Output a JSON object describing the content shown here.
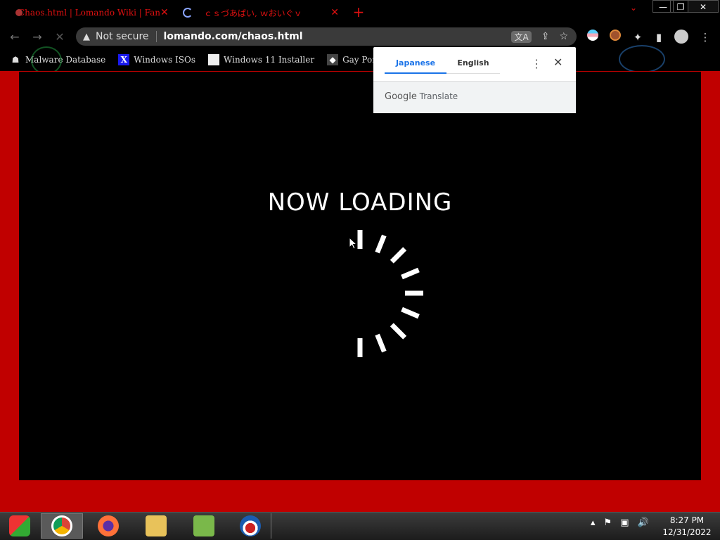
{
  "tabs": [
    {
      "title": "Chaos.html | Lomando Wiki | Fan",
      "close": "✕"
    },
    {
      "title": "ｃｓづあばい, ｗおいぐｖ",
      "close": "✕"
    }
  ],
  "new_tab": "+",
  "window_controls": {
    "minimize": "—",
    "maximize": "❐",
    "close": "✕"
  },
  "tab_search": "⌄",
  "nav": {
    "back": "←",
    "forward": "→",
    "stop": "✕"
  },
  "omnibox": {
    "warning_icon": "▲",
    "security": "Not secure",
    "url": "lomando.com/chaos.html",
    "translate_icon": "文A",
    "share_icon": "⇪",
    "bookmark_icon": "☆"
  },
  "toolbar_icons": {
    "puzzle": "✦",
    "sidebar": "▮",
    "menu": "⋮"
  },
  "bookmarks": [
    {
      "label": "Malware Database",
      "icon": "☗"
    },
    {
      "label": "Windows ISOs",
      "icon": "X"
    },
    {
      "label": "Windows 11 Installer",
      "icon": ""
    },
    {
      "label": "Gay Porn Sex Mov",
      "icon": "◆"
    }
  ],
  "page": {
    "loading_text": "NOW LOADING"
  },
  "translate_popup": {
    "tab_source": "Japanese",
    "tab_target": "English",
    "more": "⋮",
    "close": "✕",
    "brand": "Google",
    "product": "Translate"
  },
  "tray": {
    "chevron": "▴",
    "flag": "⚑",
    "network": "▣",
    "volume": "🔊"
  },
  "clock": {
    "time": "8:27 PM",
    "date": "12/31/2022"
  },
  "colors": {
    "page_border": "#c00000",
    "stage": "#000000",
    "tab_text": "#e01010",
    "translate_accent": "#1a73e8"
  }
}
